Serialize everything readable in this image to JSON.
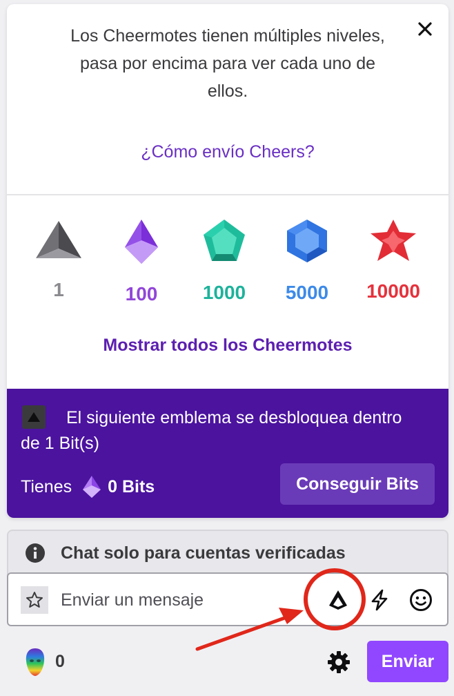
{
  "popover": {
    "info_text": "Los Cheermotes tienen múltiples niveles, pasa por encima para ver cada uno de ellos.",
    "how_link": "¿Cómo envío Cheers?",
    "close_icon": "close-icon",
    "tiers": [
      {
        "amount": "1",
        "color": "#8a8a8f",
        "icon": "gray-triangle-cheer-icon"
      },
      {
        "amount": "100",
        "color": "#9146d8",
        "icon": "purple-gem-cheer-icon"
      },
      {
        "amount": "1000",
        "color": "#1db29b",
        "icon": "teal-gem-cheer-icon"
      },
      {
        "amount": "5000",
        "color": "#3d8ae8",
        "icon": "blue-gem-cheer-icon"
      },
      {
        "amount": "10000",
        "color": "#e5323c",
        "icon": "red-star-cheer-icon"
      }
    ],
    "show_all_label": "Mostrar todos los Cheermotes"
  },
  "badge_panel": {
    "background": "#4b139e",
    "message": "El siguiente emblema se desbloquea dentro de 1 Bit(s)",
    "have_label": "Tienes",
    "bits_amount": "0 Bits",
    "get_bits_label": "Conseguir Bits"
  },
  "chat": {
    "verified_notice": "Chat solo para cuentas verificadas",
    "input_placeholder": "Enviar un mensaje",
    "points": "0",
    "send_label": "Enviar",
    "send_color": "#9147ff"
  },
  "annotation": {
    "color": "#e0271a"
  }
}
